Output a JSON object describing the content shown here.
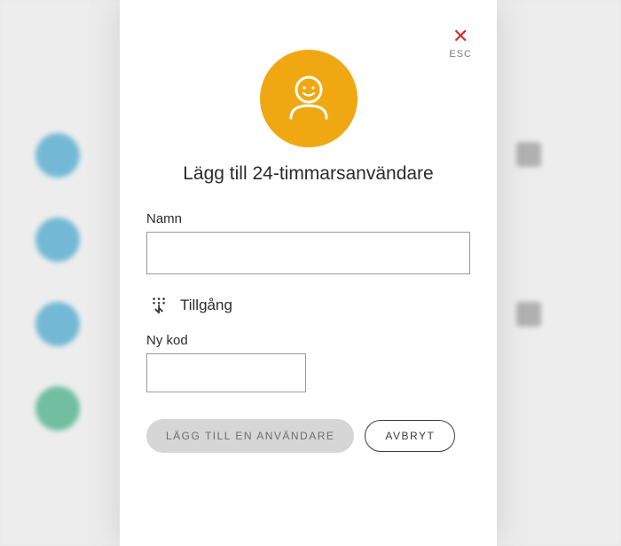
{
  "modal": {
    "close_label": "ESC",
    "title": "Lägg till 24-timmarsanvändare",
    "name_field": {
      "label": "Namn",
      "value": ""
    },
    "access_section": {
      "label": "Tillgång"
    },
    "code_field": {
      "label": "Ny kod",
      "value": ""
    },
    "buttons": {
      "add_label": "LÄGG TILL EN ANVÄNDARE",
      "cancel_label": "AVBRYT"
    }
  },
  "icons": {
    "avatar": "user-smile",
    "access": "keypad",
    "close": "close-x"
  },
  "colors": {
    "accent": "#f0a812",
    "close": "#d52b2b"
  }
}
